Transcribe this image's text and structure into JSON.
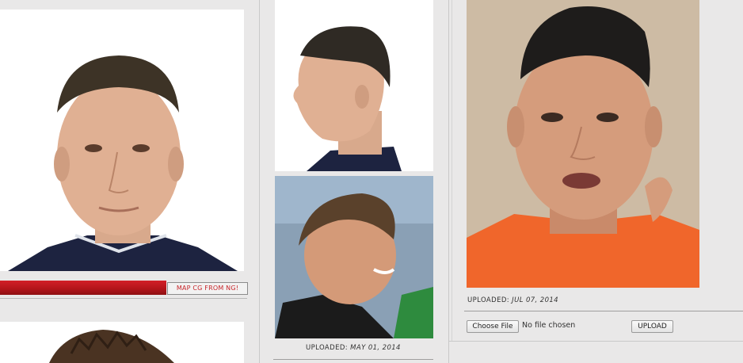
{
  "left_panel": {
    "map_button_label": "MAP CG FROM NG!",
    "progress_percent": 66
  },
  "middle_panel": {
    "uploaded_label": "UPLOADED:",
    "uploaded_date": "MAY 01, 2014"
  },
  "right_panel": {
    "uploaded_label": "UPLOADED:",
    "uploaded_date": "JUL 07, 2014",
    "choose_file_label": "Choose File",
    "no_file_text": "No file chosen",
    "upload_label": "UPLOAD"
  },
  "colors": {
    "accent_red": "#c7252a",
    "page_bg": "#e9e8e8"
  }
}
